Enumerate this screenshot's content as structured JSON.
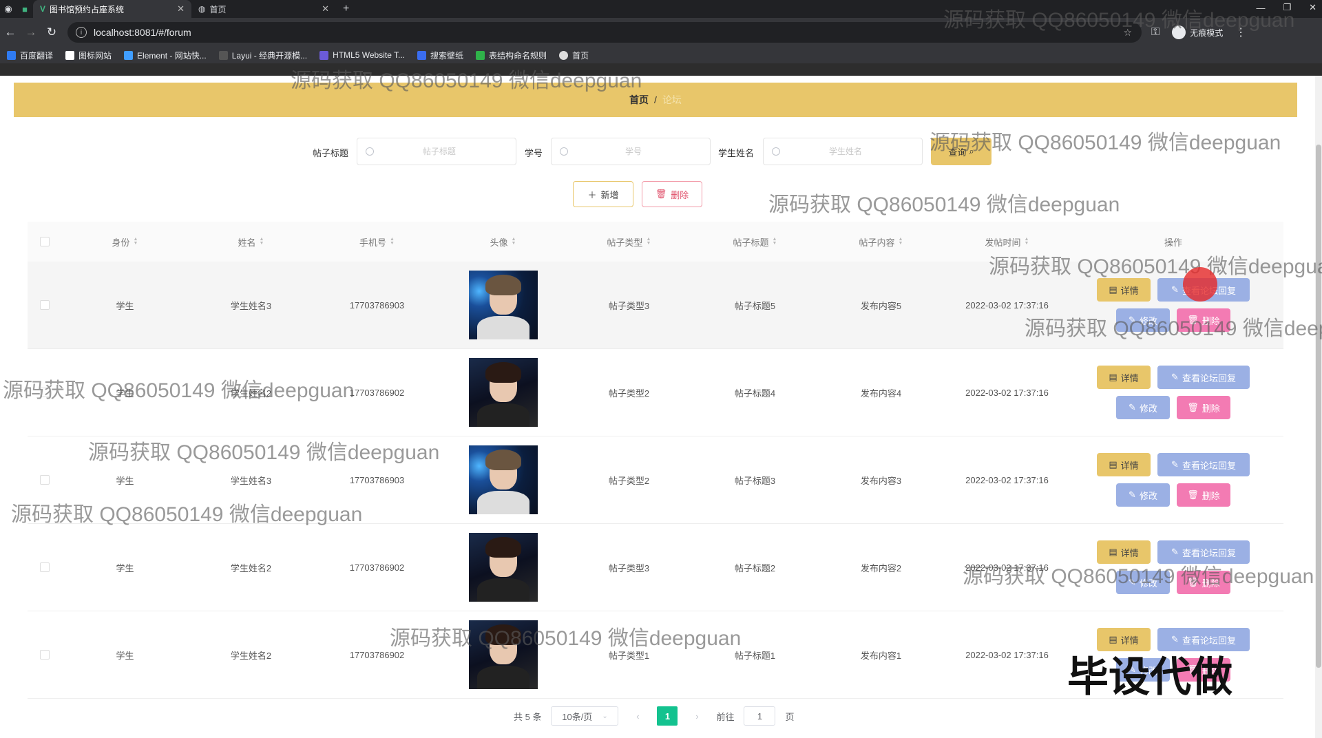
{
  "browser": {
    "tabs": [
      {
        "title": "图书馆预约占座系统",
        "active": true
      },
      {
        "title": "首页",
        "active": false
      }
    ],
    "url": "localhost:8081/#/forum",
    "profile_label": "无痕模式",
    "bookmarks": [
      "百度翻译",
      "图标网站",
      "Element - 网站快...",
      "Layui - 经典开源模...",
      "HTML5 Website T...",
      "搜索壁纸",
      "表结构命名规则",
      "首页"
    ]
  },
  "breadcrumb": {
    "home": "首页",
    "sep": "/",
    "current": "论坛"
  },
  "search": {
    "fields": [
      {
        "label": "帖子标题",
        "placeholder": "帖子标题",
        "value": ""
      },
      {
        "label": "学号",
        "placeholder": "学号",
        "value": ""
      },
      {
        "label": "学生姓名",
        "placeholder": "学生姓名",
        "value": ""
      }
    ],
    "query_label": "查询"
  },
  "actions": {
    "add_label": "新增",
    "delete_label": "删除"
  },
  "table": {
    "columns": [
      "身份",
      "姓名",
      "手机号",
      "头像",
      "帖子类型",
      "帖子标题",
      "帖子内容",
      "发帖时间",
      "操作"
    ],
    "rows": [
      {
        "identity": "学生",
        "name": "学生姓名3",
        "phone": "17703786903",
        "avatar": "avatar-blue",
        "type": "帖子类型3",
        "title": "帖子标题5",
        "content": "发布内容5",
        "time": "2022-03-02 17:37:16"
      },
      {
        "identity": "学生",
        "name": "学生姓名2",
        "phone": "17703786902",
        "avatar": "avatar-dark",
        "type": "帖子类型2",
        "title": "帖子标题4",
        "content": "发布内容4",
        "time": "2022-03-02 17:37:16"
      },
      {
        "identity": "学生",
        "name": "学生姓名3",
        "phone": "17703786903",
        "avatar": "avatar-blue",
        "type": "帖子类型2",
        "title": "帖子标题3",
        "content": "发布内容3",
        "time": "2022-03-02 17:37:16"
      },
      {
        "identity": "学生",
        "name": "学生姓名2",
        "phone": "17703786902",
        "avatar": "avatar-dark",
        "type": "帖子类型3",
        "title": "帖子标题2",
        "content": "发布内容2",
        "time": "2022-03-02 17:37:16"
      },
      {
        "identity": "学生",
        "name": "学生姓名2",
        "phone": "17703786902",
        "avatar": "avatar-dark",
        "type": "帖子类型1",
        "title": "帖子标题1",
        "content": "发布内容1",
        "time": "2022-03-02 17:37:16"
      }
    ],
    "row_actions": {
      "detail": "详情",
      "view_replies": "查看论坛回复",
      "edit": "修改",
      "delete": "删除"
    }
  },
  "pagination": {
    "total": "共 5 条",
    "page_size": "10条/页",
    "current_page": "1",
    "goto_prefix": "前往",
    "goto_value": "1",
    "goto_suffix": "页"
  },
  "watermark": {
    "text": "源码获取 QQ86050149 微信deepguan",
    "stamp": "毕设代做"
  },
  "colors": {
    "accent": "#e8c66a",
    "primary_blue": "#9bb0e4",
    "danger_pink": "#f37bb3",
    "pager_active": "#13c28f"
  }
}
